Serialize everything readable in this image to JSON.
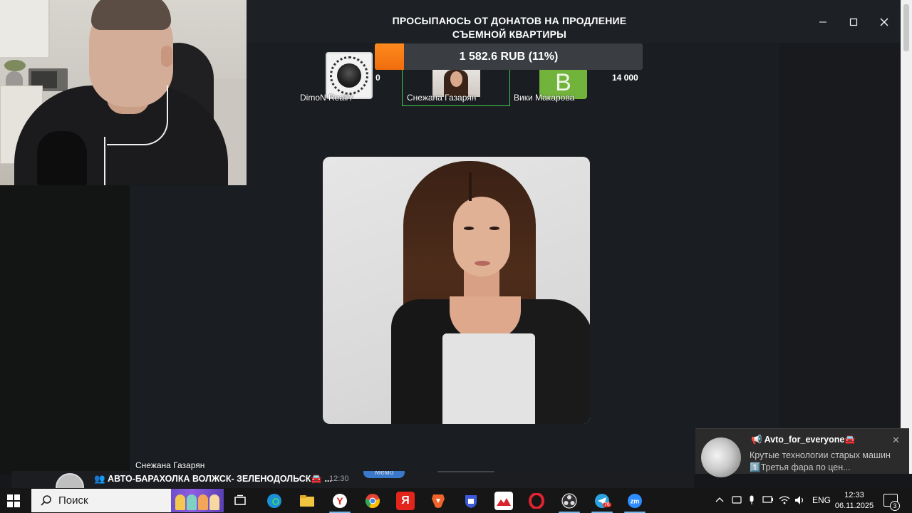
{
  "stream": {
    "title_line1": "ПРОСЫПАЮСЬ ОТ ДОНАТОВ НА ПРОДЛЕНИЕ",
    "title_line2": "СЪЕМНОЙ КВАРТИРЫ",
    "progress_text": "1 582.6 RUB (11%)",
    "progress_fraction": 0.11,
    "accent": "#f57c13",
    "featured_border": "#3fd14d"
  },
  "donors": [
    {
      "name": "DimoN ReallY",
      "amount": "0",
      "avatar_icon": "wolf-emblem-icon"
    },
    {
      "name": "Снежана Газарян",
      "amount": "",
      "avatar_icon": "portrait-photo"
    },
    {
      "name": "Вики Макарова",
      "amount": "14 000",
      "avatar_letter": "B",
      "avatar_color": "#72b33c"
    }
  ],
  "caption": "Снежана Газарян",
  "ticker": {
    "text": "👥 АВТО-БАРАХОЛКА ВОЛЖСК- ЗЕЛЕНОДОЛЬСК🚘 ...",
    "time": "12:30",
    "pill": "Meмo"
  },
  "toast": {
    "title": "📢 Avto_for_everyone🚘",
    "body": "Крутые технологии старых машин 1️⃣Третья фара по цен..."
  },
  "taskbar": {
    "search_placeholder": "Поиск",
    "apps": [
      "task-view",
      "edge",
      "file-explorer",
      "yandex-browser",
      "chrome",
      "yandex",
      "brave",
      "keepassxc",
      "photo-app",
      "opera",
      "obs",
      "telegram",
      "zoom"
    ],
    "telegram_badge": "76",
    "language": "ENG",
    "time": "12:33",
    "date": "06.11.2025",
    "notifications": "3"
  }
}
